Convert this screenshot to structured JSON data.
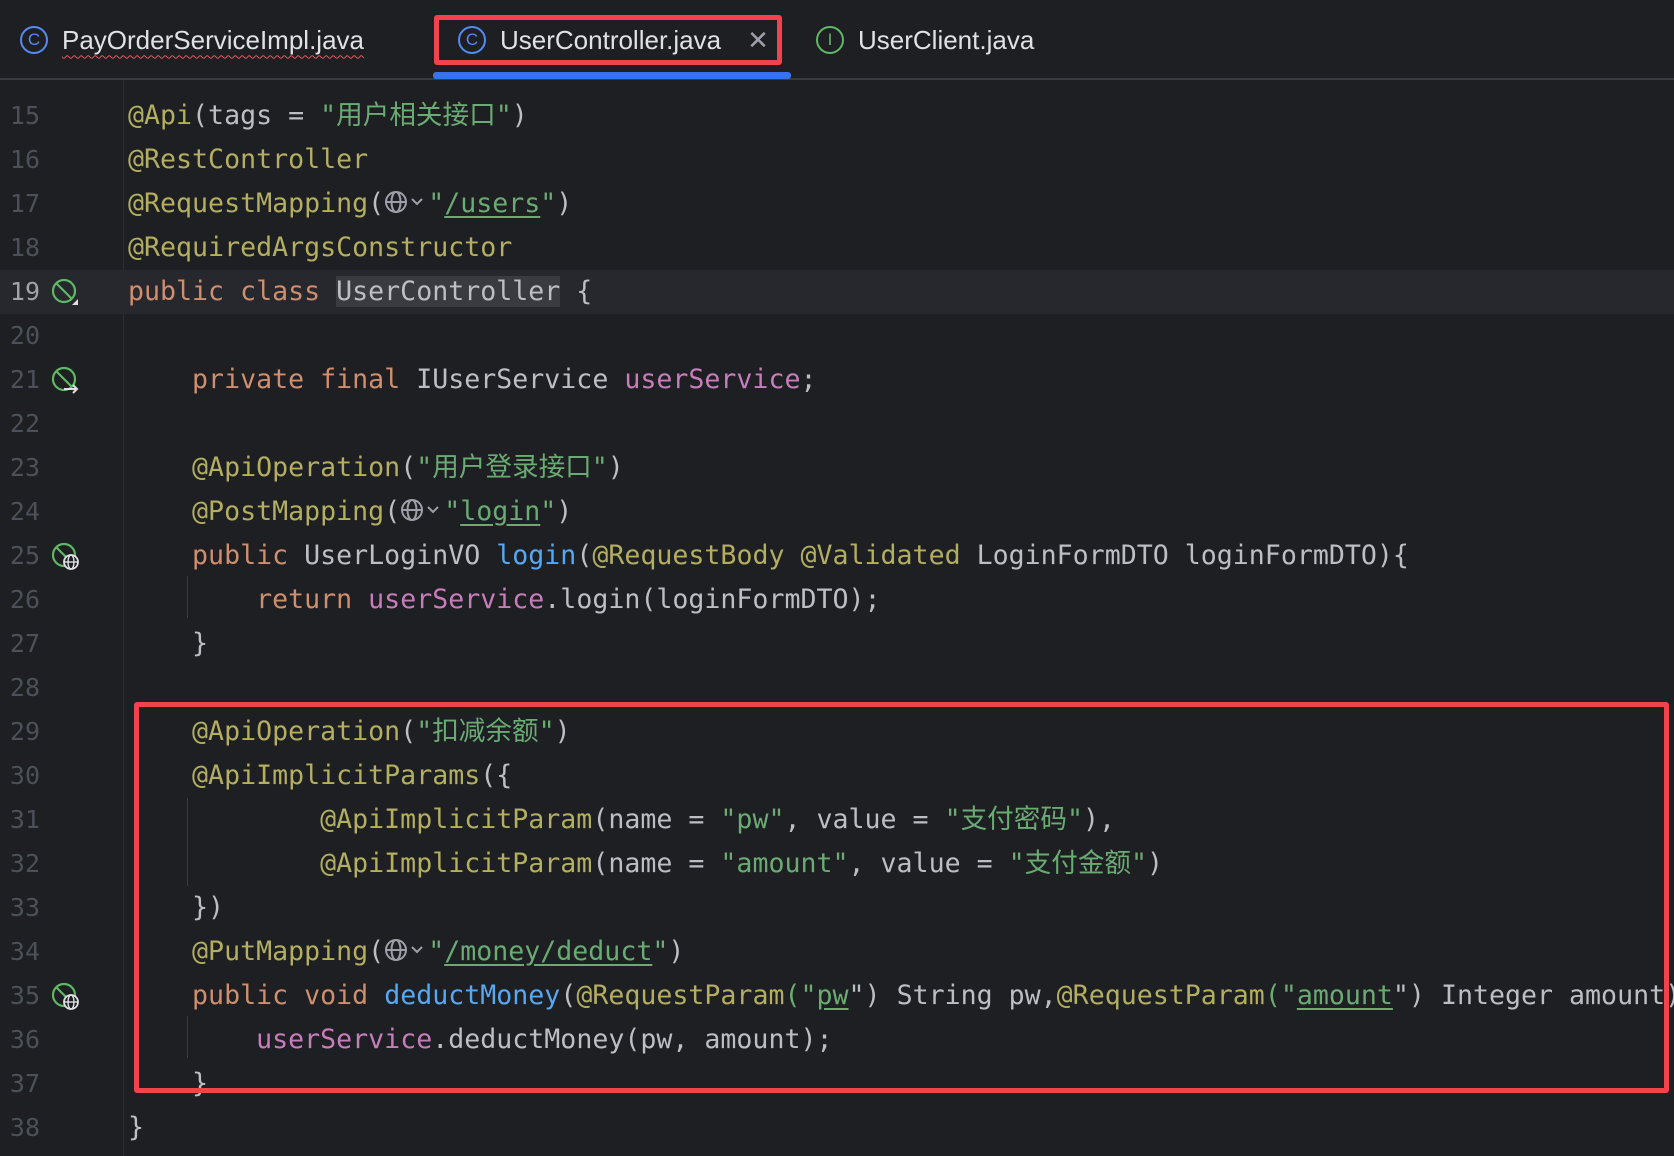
{
  "tabs": [
    {
      "label": "PayOrderServiceImpl.java",
      "icon": "class-icon",
      "icon_glyph": "C"
    },
    {
      "label": "UserController.java",
      "icon": "class-icon",
      "icon_glyph": "C",
      "active": true,
      "close_glyph": "✕"
    },
    {
      "label": "UserClient.java",
      "icon": "interface-icon",
      "icon_glyph": "I"
    }
  ],
  "colors": {
    "background": "#1e1f22",
    "keyword": "#cf8e6d",
    "annotation": "#b3ae60",
    "string": "#6aab73",
    "field": "#c77dbb",
    "method": "#56a8f5",
    "highlight_box": "#f2424d",
    "active_tab_underline": "#3574f0"
  },
  "editor": {
    "lines": [
      {
        "num": "15",
        "t": [
          "@Api",
          "(tags = ",
          "\"用户相关接口\"",
          ")"
        ]
      },
      {
        "num": "16",
        "t": [
          "@RestController"
        ]
      },
      {
        "num": "17",
        "t": [
          "@RequestMapping",
          "(",
          "\"",
          "/users",
          "\"",
          ")"
        ]
      },
      {
        "num": "18",
        "t": [
          "@RequiredArgsConstructor"
        ]
      },
      {
        "num": "19",
        "t": [
          "public class ",
          "UserController",
          " {"
        ]
      },
      {
        "num": "20",
        "t": []
      },
      {
        "num": "21",
        "t": [
          "    private final ",
          "IUserService ",
          "userService",
          ";"
        ]
      },
      {
        "num": "22",
        "t": []
      },
      {
        "num": "23",
        "t": [
          "    @ApiOperation",
          "(",
          "\"用户登录接口\"",
          ")"
        ]
      },
      {
        "num": "24",
        "t": [
          "    @PostMapping",
          "(",
          "\"",
          "login",
          "\"",
          ")"
        ]
      },
      {
        "num": "25",
        "t": [
          "    public ",
          "UserLoginVO ",
          "login",
          "(",
          "@RequestBody @Validated ",
          "LoginFormDTO loginFormDTO){"
        ]
      },
      {
        "num": "26",
        "t": [
          "        return ",
          "userService",
          ".login(loginFormDTO);"
        ]
      },
      {
        "num": "27",
        "t": [
          "    }"
        ]
      },
      {
        "num": "28",
        "t": []
      },
      {
        "num": "29",
        "t": [
          "    @ApiOperation",
          "(",
          "\"扣减余额\"",
          ")"
        ]
      },
      {
        "num": "30",
        "t": [
          "    @ApiImplicitParams",
          "({"
        ]
      },
      {
        "num": "31",
        "t": [
          "            @ApiImplicitParam",
          "(name = ",
          "\"pw\"",
          ", value = ",
          "\"支付密码\"",
          "),"
        ]
      },
      {
        "num": "32",
        "t": [
          "            @ApiImplicitParam",
          "(name = ",
          "\"amount\"",
          ", value = ",
          "\"支付金额\"",
          ")"
        ]
      },
      {
        "num": "33",
        "t": [
          "    })"
        ]
      },
      {
        "num": "34",
        "t": [
          "    @PutMapping",
          "(",
          "\"",
          "/money/deduct",
          "\"",
          ")"
        ]
      },
      {
        "num": "35",
        "t": [
          "    public void ",
          "deductMoney",
          "(",
          "@RequestParam",
          "(\"",
          "pw",
          "\") String pw,",
          "@RequestParam",
          "(\"",
          "amount",
          "\") Integer amount){"
        ]
      },
      {
        "num": "36",
        "t": [
          "        ",
          "userService",
          ".deductMoney(pw, amount);"
        ]
      },
      {
        "num": "37",
        "t": [
          "    }"
        ]
      },
      {
        "num": "38",
        "t": [
          "}"
        ]
      }
    ]
  }
}
